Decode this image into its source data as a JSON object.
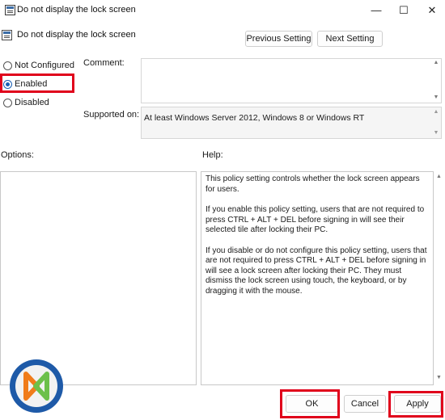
{
  "window": {
    "title": "Do not display the lock screen",
    "controls": {
      "minimize": "—",
      "maximize": "☐",
      "close": "✕"
    }
  },
  "header": {
    "policy_title": "Do not display the lock screen",
    "previous_setting": "Previous Setting",
    "next_setting": "Next Setting"
  },
  "state_options": [
    {
      "label": "Not Configured",
      "selected": false
    },
    {
      "label": "Enabled",
      "selected": true
    },
    {
      "label": "Disabled",
      "selected": false
    }
  ],
  "comment": {
    "label": "Comment:",
    "value": ""
  },
  "supported": {
    "label": "Supported on:",
    "value": "At least Windows Server 2012, Windows 8 or Windows RT"
  },
  "options": {
    "label": "Options:"
  },
  "help": {
    "label": "Help:",
    "paragraphs": [
      "This policy setting controls whether the lock screen appears for users.",
      "If you enable this policy setting, users that are not required to press CTRL + ALT + DEL before signing in will see their selected tile after locking their PC.",
      "If you disable or do not configure this policy setting, users that are not required to press CTRL + ALT + DEL before signing in will see a lock screen after locking their PC. They must dismiss the lock screen using touch, the keyboard, or by dragging it with the mouse."
    ]
  },
  "footer": {
    "ok": "OK",
    "cancel": "Cancel",
    "apply": "Apply"
  },
  "colors": {
    "highlight": "#e0001b",
    "radio_accent": "#1a5fb4",
    "logo_ring": "#1e5aa8",
    "logo_fill": "#f2f2f2",
    "logo_orange": "#f07c1a",
    "logo_green": "#6cc04a"
  }
}
